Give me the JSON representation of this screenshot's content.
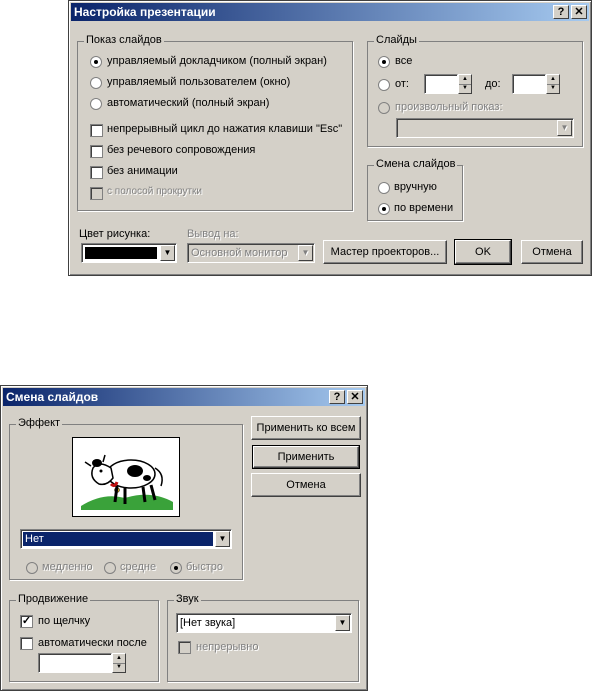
{
  "dialog1": {
    "title": "Настройка презентации",
    "help_btn": "?",
    "close_btn": "✕",
    "show_group": {
      "legend": "Показ слайдов",
      "radios": [
        {
          "label": "управляемый докладчиком (полный экран)",
          "checked": true
        },
        {
          "label": "управляемый пользователем (окно)",
          "checked": false
        },
        {
          "label": "автоматический (полный экран)",
          "checked": false
        }
      ],
      "checks": [
        {
          "label": "непрерывный цикл до нажатия клавиши \"Esc\"",
          "checked": false,
          "disabled": false
        },
        {
          "label": "без речевого сопровождения",
          "checked": false,
          "disabled": false
        },
        {
          "label": "без анимации",
          "checked": false,
          "disabled": false
        },
        {
          "label": "с полосой прокрутки",
          "checked": false,
          "disabled": true
        }
      ]
    },
    "slides_group": {
      "legend": "Слайды",
      "all": "все",
      "from": "от:",
      "to": "до:",
      "custom": "произвольный показ:",
      "from_value": "",
      "to_value": "",
      "custom_value": ""
    },
    "change_group": {
      "legend": "Смена слайдов",
      "manual": "вручную",
      "timed": "по времени"
    },
    "pen_color_label": "Цвет рисунка:",
    "pen_color": "#000000",
    "output_label": "Вывод на:",
    "output_value": "Основной монитор",
    "wizard_button": "Мастер проекторов...",
    "ok_button": "OK",
    "cancel_button": "Отмена"
  },
  "dialog2": {
    "title": "Смена слайдов",
    "help_btn": "?",
    "close_btn": "✕",
    "effect_legend": "Эффект",
    "effect_value": "Нет",
    "speed": {
      "slow": "медленно",
      "medium": "средне",
      "fast": "быстро"
    },
    "apply_all_button": "Применить ко всем",
    "apply_button": "Применить",
    "cancel_button": "Отмена",
    "advance_legend": "Продвижение",
    "on_click": "по щелчку",
    "auto_after": "автоматически после",
    "auto_value": "",
    "sound_legend": "Звук",
    "sound_value": "[Нет звука]",
    "loop": "непрерывно"
  }
}
